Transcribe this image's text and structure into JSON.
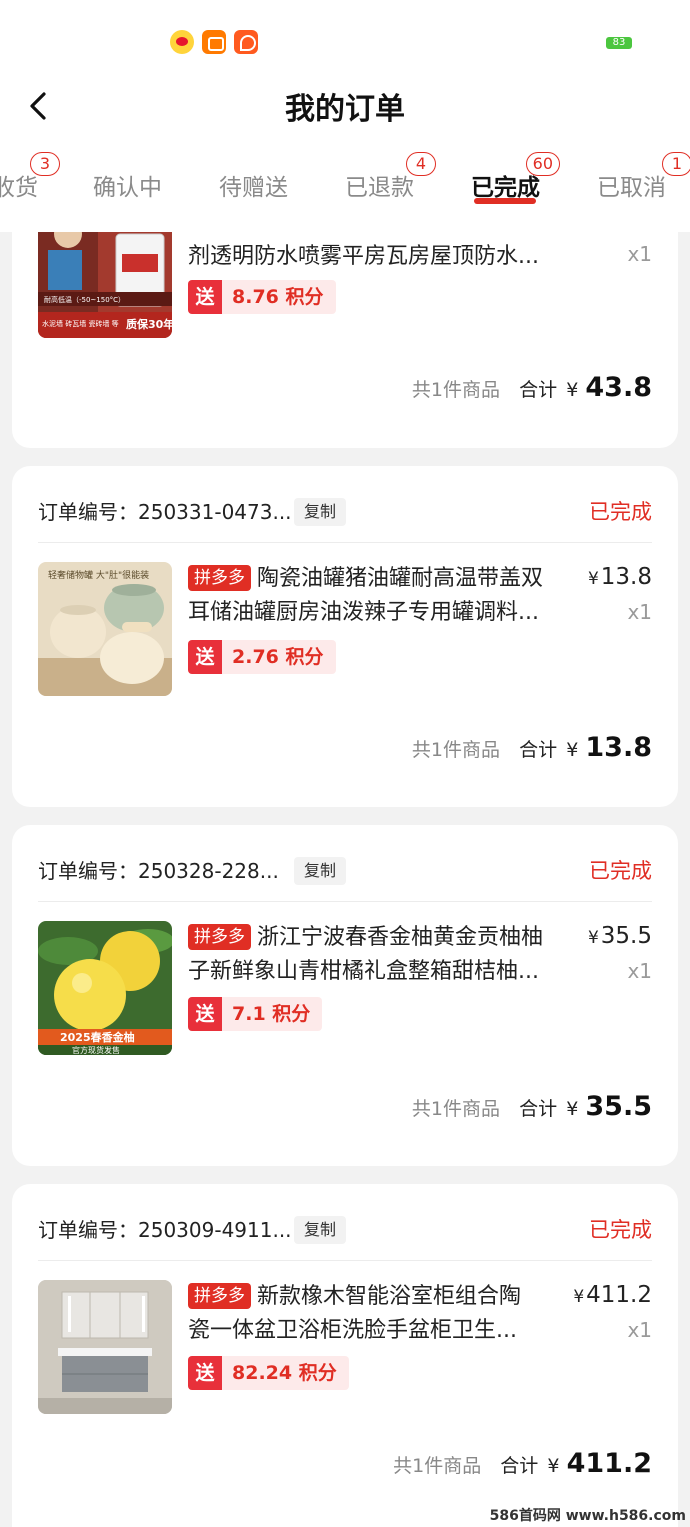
{
  "status_bar": {
    "battery": "83"
  },
  "header": {
    "title": "我的订单"
  },
  "tabs": [
    {
      "label": "收货",
      "badge": "3"
    },
    {
      "label": "确认中",
      "badge": ""
    },
    {
      "label": "待赠送",
      "badge": ""
    },
    {
      "label": "已退款",
      "badge": "4"
    },
    {
      "label": "已完成",
      "badge": "60"
    },
    {
      "label": "已取消",
      "badge": "1"
    }
  ],
  "orders": [
    {
      "title_line1": "剂透明防水喷雾平房瓦房屋顶防水...",
      "qty": "x1",
      "send_label": "送",
      "points": "8.76 积分",
      "count_label": "共1件商品",
      "total_label": "合计",
      "currency": "¥",
      "total": "43.8",
      "img_badge": "质保30年",
      "img_text1": "耐高低温（-50~150°C）",
      "img_text2": "水泥墙 砖瓦墙 瓷砖墙 等"
    },
    {
      "order_no": "订单编号：250331-0473...",
      "copy": "复制",
      "status": "已完成",
      "tag": "拼多多",
      "title_line1": "陶瓷油罐猪油罐耐高温带盖双",
      "title_line2": "耳储油罐厨房油泼辣子专用罐调料...",
      "currency": "¥",
      "price": "13.8",
      "qty": "x1",
      "send_label": "送",
      "points": "2.76 积分",
      "count_label": "共1件商品",
      "total_label": "合计",
      "total": "13.8",
      "img_text": "轻奢储物罐 大\"肚\"很能装"
    },
    {
      "order_no": "订单编号：250328-228...",
      "copy": "复制",
      "status": "已完成",
      "tag": "拼多多",
      "title_line1": "浙江宁波春香金柚黄金贡柚柚",
      "title_line2": "子新鲜象山青柑橘礼盒整箱甜桔柚...",
      "currency": "¥",
      "price": "35.5",
      "qty": "x1",
      "send_label": "送",
      "points": "7.1 积分",
      "count_label": "共1件商品",
      "total_label": "合计",
      "total": "35.5",
      "img_text1": "2025春香金柚",
      "img_text2": "官方现货发售"
    },
    {
      "order_no": "订单编号：250309-4911...",
      "copy": "复制",
      "status": "已完成",
      "tag": "拼多多",
      "title_line1": "新款橡木智能浴室柜组合陶",
      "title_line2": "瓷一体盆卫浴柜洗脸手盆柜卫生...",
      "currency": "¥",
      "price": "411.2",
      "qty": "x1",
      "send_label": "送",
      "points": "82.24 积分",
      "count_label": "共1件商品",
      "total_label": "合计",
      "total": "411.2"
    }
  ],
  "watermark": "586首码网 www.h586.com",
  "colors": {
    "accent": "#e02e24",
    "background": "#f2f2f2",
    "card": "#ffffff"
  }
}
